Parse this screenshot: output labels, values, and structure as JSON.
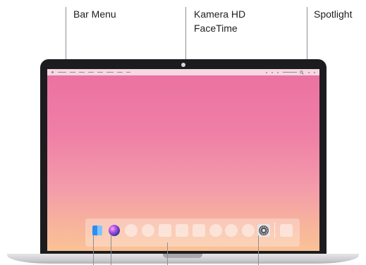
{
  "callouts": {
    "menu_bar": "Bar Menu",
    "camera_line1": "Kamera HD",
    "camera_line2": "FaceTime",
    "spotlight": "Spotlight"
  },
  "icons": {
    "finder": "finder-icon",
    "siri": "siri-icon",
    "system_preferences": "system-preferences-icon",
    "spotlight": "magnifier-icon"
  },
  "colors": {
    "wallpaper_top": "#ea71a0",
    "wallpaper_bottom": "#fac296",
    "lid": "#1c1c1e",
    "label_text": "#1d1d1f"
  }
}
